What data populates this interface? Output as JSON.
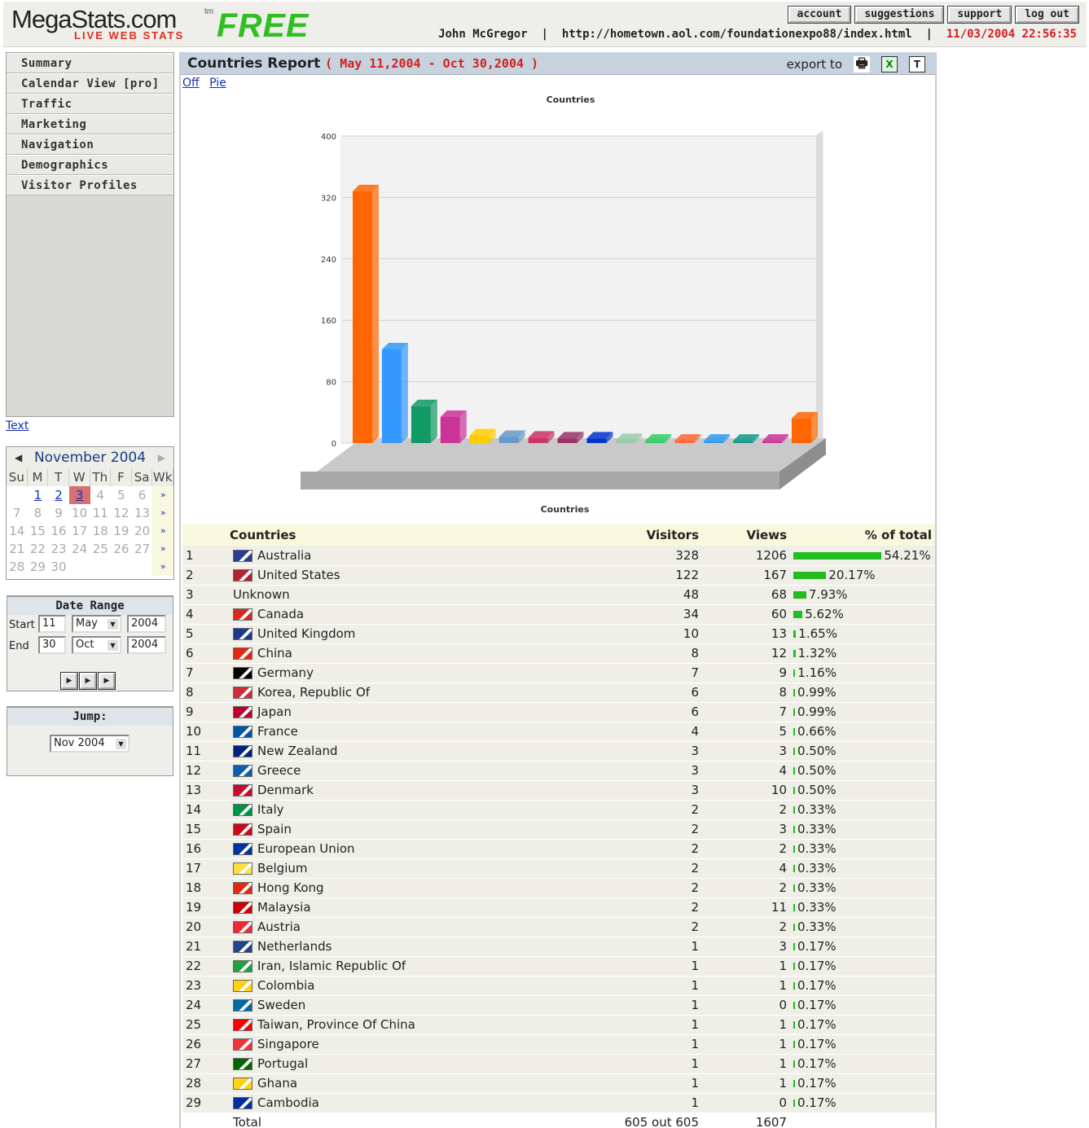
{
  "header": {
    "logo_main": "MegaStats.com",
    "logo_tm": "tm",
    "logo_sub": "LIVE WEB STATS",
    "free_label": "FREE",
    "buttons": [
      "account",
      "suggestions",
      "support",
      "log out"
    ],
    "user_name": "John McGregor",
    "sep": "|",
    "site_url": "http://hometown.aol.com/foundationexpo88/index.html",
    "datetime": "11/03/2004 22:56:35"
  },
  "nav": {
    "items": [
      "Summary",
      "Calendar View [pro]",
      "Traffic",
      "Marketing",
      "Navigation",
      "Demographics",
      "Visitor Profiles"
    ],
    "text_link": "Text"
  },
  "calendar": {
    "month_label": "November 2004",
    "day_headers": [
      "Su",
      "M",
      "T",
      "W",
      "Th",
      "F",
      "Sa",
      "Wk"
    ],
    "weeks": [
      [
        "",
        "1",
        "2",
        "3",
        "4",
        "5",
        "6",
        "»"
      ],
      [
        "7",
        "8",
        "9",
        "10",
        "11",
        "12",
        "13",
        "»"
      ],
      [
        "14",
        "15",
        "16",
        "17",
        "18",
        "19",
        "20",
        "»"
      ],
      [
        "21",
        "22",
        "23",
        "24",
        "25",
        "26",
        "27",
        "»"
      ],
      [
        "28",
        "29",
        "30",
        "",
        "",
        "",
        "",
        "»"
      ]
    ],
    "active_days": [
      "1",
      "2",
      "3"
    ],
    "today": "3"
  },
  "date_range": {
    "title": "Date Range",
    "start_label": "Start",
    "start_day": "11",
    "start_month": "May",
    "start_year": "2004",
    "end_label": "End",
    "end_day": "30",
    "end_month": "Oct",
    "end_year": "2004"
  },
  "jump": {
    "title": "Jump:",
    "value": "Nov 2004"
  },
  "report": {
    "title": "Countries Report",
    "range": "( May 11,2004 - Oct 30,2004 )",
    "export_label": "export to",
    "view_links": [
      "Off",
      "Pie"
    ]
  },
  "chart_data": {
    "type": "bar",
    "title": "Countries",
    "xlabel": "Countries",
    "ylabel": "",
    "ylim": [
      0,
      400
    ],
    "yticks": [
      0,
      80,
      160,
      240,
      320,
      400
    ],
    "grid": true,
    "values": [
      328,
      122,
      48,
      34,
      10,
      8,
      7,
      6,
      6,
      4,
      3,
      3,
      3,
      2,
      2,
      2,
      32
    ],
    "colors": [
      "#ff6600",
      "#3399ff",
      "#119966",
      "#cc3399",
      "#ffcc00",
      "#6699cc",
      "#cc3366",
      "#993366",
      "#0033cc",
      "#99ccaa",
      "#33cc66",
      "#ff6633",
      "#3399ee",
      "#119988",
      "#cc3399"
    ]
  },
  "table": {
    "headers": [
      "Countries",
      "Visitors",
      "Views",
      "% of total"
    ],
    "rows": [
      [
        "1",
        "Australia",
        "328",
        "1206",
        "54.21%",
        54.21
      ],
      [
        "2",
        "United States",
        "122",
        "167",
        "20.17%",
        20.17
      ],
      [
        "3",
        "Unknown",
        "48",
        "68",
        "7.93%",
        7.93
      ],
      [
        "4",
        "Canada",
        "34",
        "60",
        "5.62%",
        5.62
      ],
      [
        "5",
        "United Kingdom",
        "10",
        "13",
        "1.65%",
        1.65
      ],
      [
        "6",
        "China",
        "8",
        "12",
        "1.32%",
        1.32
      ],
      [
        "7",
        "Germany",
        "7",
        "9",
        "1.16%",
        1.16
      ],
      [
        "8",
        "Korea, Republic Of",
        "6",
        "8",
        "0.99%",
        0.99
      ],
      [
        "9",
        "Japan",
        "6",
        "7",
        "0.99%",
        0.99
      ],
      [
        "10",
        "France",
        "4",
        "5",
        "0.66%",
        0.66
      ],
      [
        "11",
        "New Zealand",
        "3",
        "3",
        "0.50%",
        0.5
      ],
      [
        "12",
        "Greece",
        "3",
        "4",
        "0.50%",
        0.5
      ],
      [
        "13",
        "Denmark",
        "3",
        "10",
        "0.50%",
        0.5
      ],
      [
        "14",
        "Italy",
        "2",
        "2",
        "0.33%",
        0.33
      ],
      [
        "15",
        "Spain",
        "2",
        "3",
        "0.33%",
        0.33
      ],
      [
        "16",
        "European Union",
        "2",
        "2",
        "0.33%",
        0.33
      ],
      [
        "17",
        "Belgium",
        "2",
        "4",
        "0.33%",
        0.33
      ],
      [
        "18",
        "Hong Kong",
        "2",
        "2",
        "0.33%",
        0.33
      ],
      [
        "19",
        "Malaysia",
        "2",
        "11",
        "0.33%",
        0.33
      ],
      [
        "20",
        "Austria",
        "2",
        "2",
        "0.33%",
        0.33
      ],
      [
        "21",
        "Netherlands",
        "1",
        "3",
        "0.17%",
        0.17
      ],
      [
        "22",
        "Iran, Islamic Republic Of",
        "1",
        "1",
        "0.17%",
        0.17
      ],
      [
        "23",
        "Colombia",
        "1",
        "1",
        "0.17%",
        0.17
      ],
      [
        "24",
        "Sweden",
        "1",
        "0",
        "0.17%",
        0.17
      ],
      [
        "25",
        "Taiwan, Province Of China",
        "1",
        "1",
        "0.17%",
        0.17
      ],
      [
        "26",
        "Singapore",
        "1",
        "1",
        "0.17%",
        0.17
      ],
      [
        "27",
        "Portugal",
        "1",
        "1",
        "0.17%",
        0.17
      ],
      [
        "28",
        "Ghana",
        "1",
        "1",
        "0.17%",
        0.17
      ],
      [
        "29",
        "Cambodia",
        "1",
        "0",
        "0.17%",
        0.17
      ]
    ],
    "flag_colors": [
      "#2a3d8f",
      "#b22234",
      "",
      "#d52b1e",
      "#1d3a8a",
      "#de2910",
      "#000000",
      "#cd2e3a",
      "#bc002d",
      "#0055a4",
      "#00247d",
      "#0d5eaf",
      "#c60c30",
      "#009246",
      "#c60b1e",
      "#003399",
      "#fae042",
      "#de2910",
      "#cc0001",
      "#ed2939",
      "#21468b",
      "#239f40",
      "#fcd116",
      "#006aa7",
      "#fe0000",
      "#ef3340",
      "#006600",
      "#fcd116",
      "#032ea1"
    ],
    "total_label": "Total",
    "total_visitors": "605 out 605",
    "total_views": "1607"
  }
}
